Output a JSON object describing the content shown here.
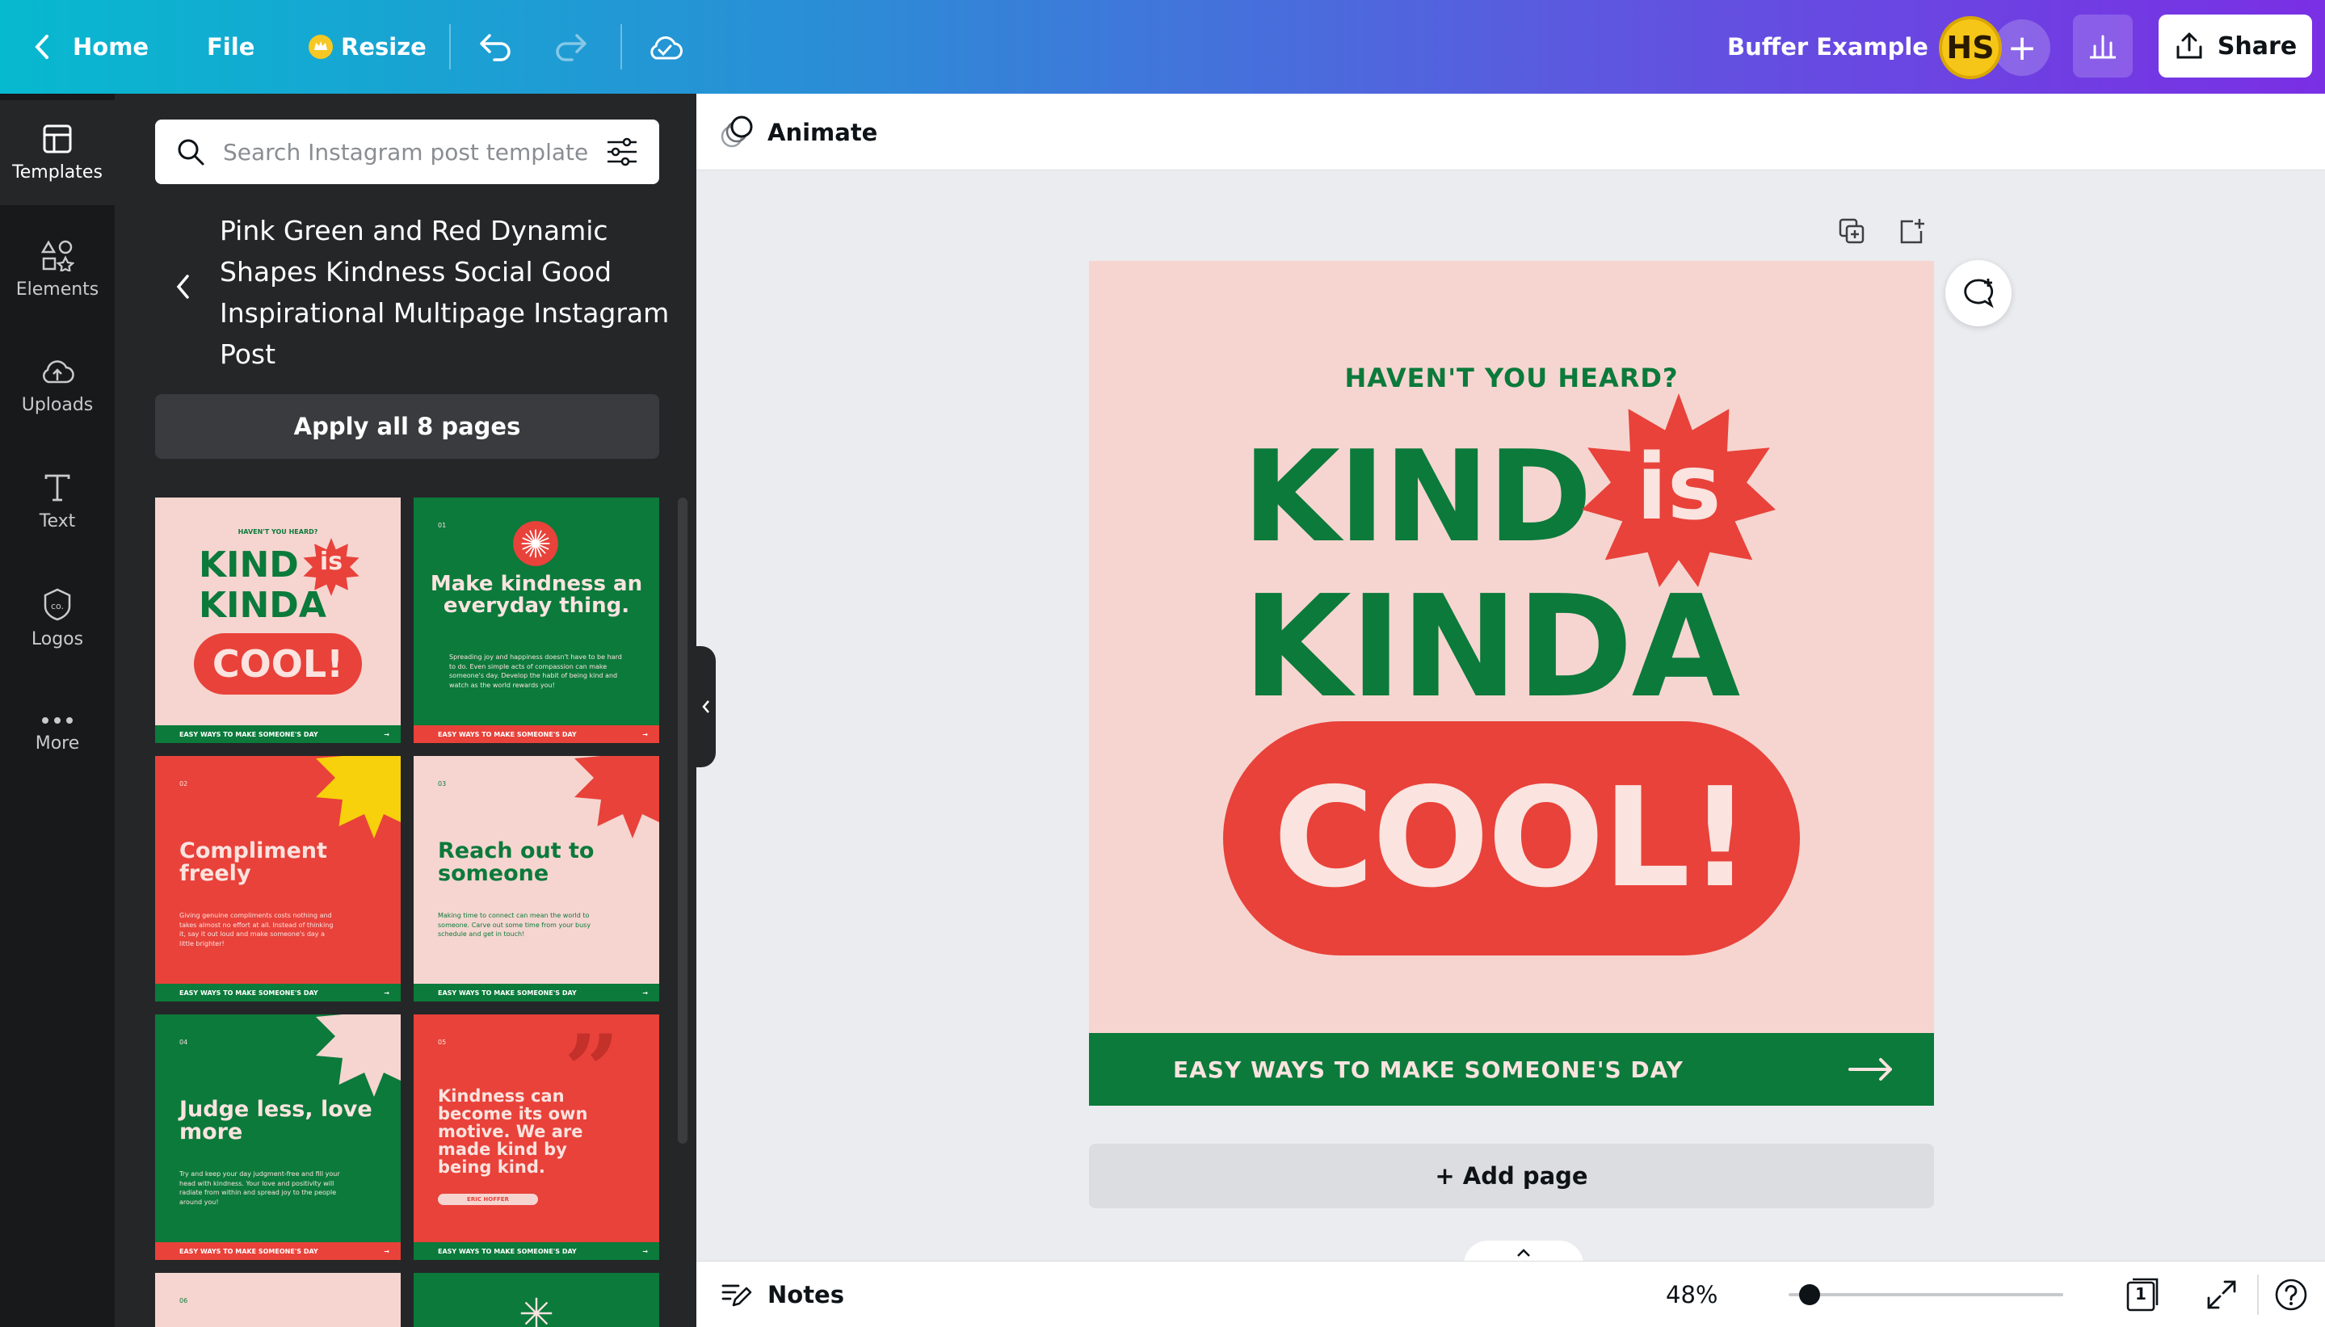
{
  "topbar": {
    "home": "Home",
    "file": "File",
    "resize": "Resize",
    "doc_title": "Buffer Example",
    "avatar_initials": "HS",
    "share": "Share"
  },
  "rail": [
    {
      "label": "Templates",
      "icon": "templates-icon"
    },
    {
      "label": "Elements",
      "icon": "elements-icon"
    },
    {
      "label": "Uploads",
      "icon": "uploads-icon"
    },
    {
      "label": "Text",
      "icon": "text-icon"
    },
    {
      "label": "Logos",
      "icon": "logos-icon"
    },
    {
      "label": "More",
      "icon": "more-icon"
    }
  ],
  "panel": {
    "search_placeholder": "Search Instagram post templates",
    "template_title": "Pink Green and Red Dynamic Shapes Kindness Social Good Inspirational Multipage Instagram Post",
    "apply_label": "Apply all 8 pages"
  },
  "thumbs": {
    "footer": "EASY WAYS TO MAKE SOMEONE'S DAY",
    "t1": {
      "kicker": "HAVEN'T YOU HEARD?",
      "line1": "KIND",
      "is": "is",
      "line2": "KINDA",
      "cool": "COOL!"
    },
    "t2": {
      "num": "01",
      "title": "Make kindness an everyday thing.",
      "body": "Spreading joy and happiness doesn't have to be hard to do. Even simple acts of compassion can make someone's day. Develop the habit of being kind and watch as the world rewards you!"
    },
    "t3": {
      "num": "02",
      "title": "Compliment freely",
      "body": "Giving genuine compliments costs nothing and takes almost no effort at all. Instead of thinking it, say it out loud and make someone's day a little brighter!"
    },
    "t4": {
      "num": "03",
      "title": "Reach out to someone",
      "body": "Making time to connect can mean the world to someone. Carve out some time from your busy schedule and get in touch!"
    },
    "t5": {
      "num": "04",
      "title": "Judge less, love more",
      "body": "Try and keep your day judgment-free and fill your head with kindness. Your love and positivity will radiate from within and spread joy to the people around you!"
    },
    "t6": {
      "num": "05",
      "quote": "Kindness can become its own motive. We are made kind by being kind.",
      "author": "ERIC HOFFER"
    },
    "t7": {
      "num": "06"
    }
  },
  "workspace": {
    "animate": "Animate",
    "add_page": "+ Add page",
    "notes": "Notes",
    "zoom": "48%",
    "zoom_level": 0.48,
    "page_count": "1"
  },
  "design": {
    "kicker": "HAVEN'T YOU HEARD?",
    "line1": "KIND",
    "is": "is",
    "line2": "KINDA",
    "cool": "COOL!",
    "footer": "EASY WAYS TO MAKE SOMEONE'S DAY"
  },
  "colors": {
    "pink": "#f6d5d0",
    "green": "#0b7a3b",
    "red": "#e8423a",
    "yellow": "#f7d10b"
  }
}
